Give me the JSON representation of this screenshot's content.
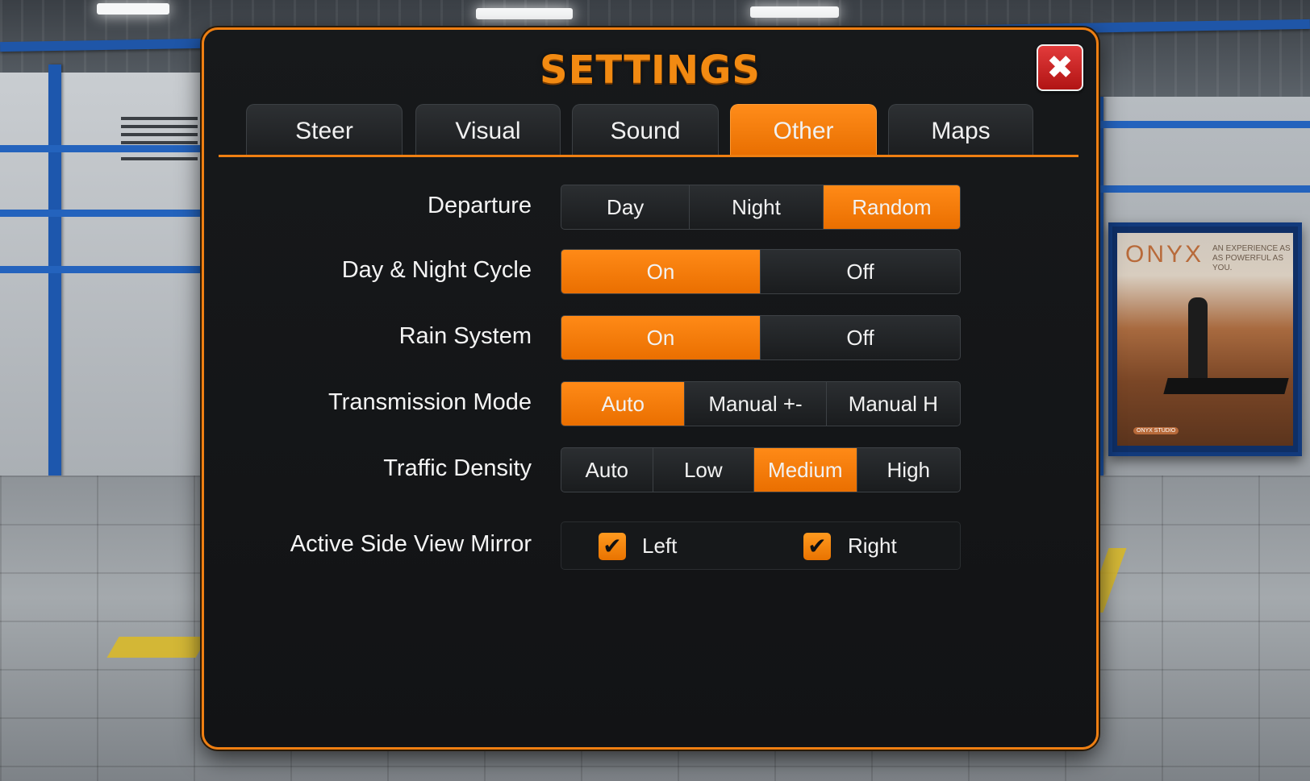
{
  "panel": {
    "title": "SETTINGS",
    "close_glyph": "✖",
    "accent_color": "#ef7f12"
  },
  "tabs": [
    {
      "label": "Steer",
      "active": false
    },
    {
      "label": "Visual",
      "active": false
    },
    {
      "label": "Sound",
      "active": false
    },
    {
      "label": "Other",
      "active": true
    },
    {
      "label": "Maps",
      "active": false
    }
  ],
  "settings": {
    "departure": {
      "label": "Departure",
      "options": [
        "Day",
        "Night",
        "Random"
      ],
      "selected": "Random"
    },
    "day_night_cycle": {
      "label": "Day & Night Cycle",
      "options": [
        "On",
        "Off"
      ],
      "selected": "On"
    },
    "rain_system": {
      "label": "Rain System",
      "options": [
        "On",
        "Off"
      ],
      "selected": "On"
    },
    "transmission_mode": {
      "label": "Transmission Mode",
      "options": [
        "Auto",
        "Manual +-",
        "Manual H"
      ],
      "selected": "Auto"
    },
    "traffic_density": {
      "label": "Traffic Density",
      "options": [
        "Auto",
        "Low",
        "Medium",
        "High"
      ],
      "selected": "Medium"
    },
    "side_view_mirror": {
      "label": "Active Side View Mirror",
      "left": {
        "label": "Left",
        "checked": true
      },
      "right": {
        "label": "Right",
        "checked": true
      },
      "check_glyph": "✔"
    }
  },
  "poster": {
    "brand": "ONYX",
    "tagline": "AN EXPERIENCE AS AS POWERFUL AS YOU.",
    "badge": "ONYX STUDIO"
  }
}
